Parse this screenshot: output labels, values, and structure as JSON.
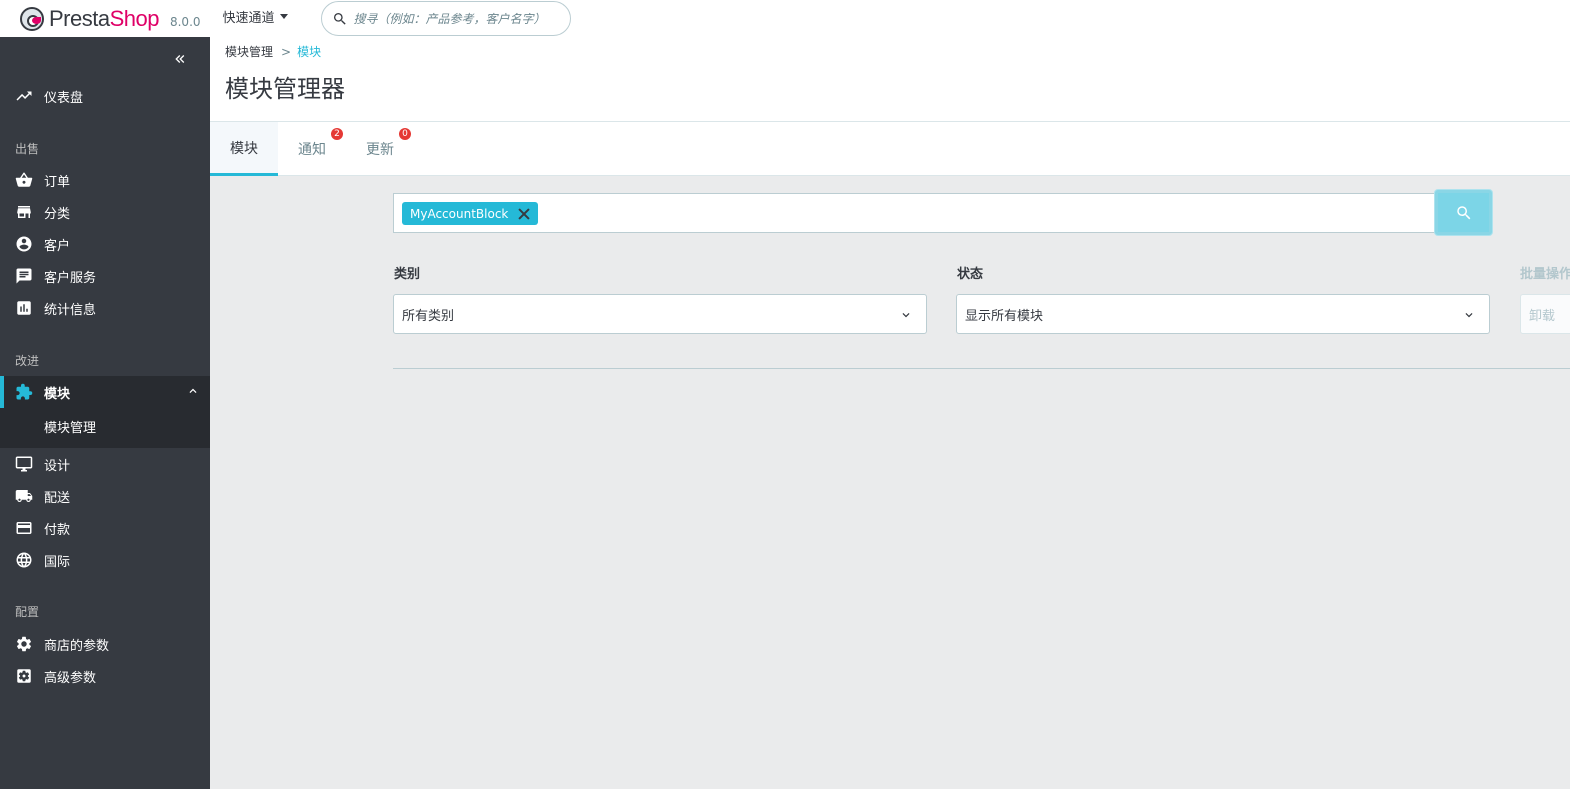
{
  "header": {
    "logo_prefix": "Presta",
    "logo_suffix": "Shop",
    "version": "8.0.0",
    "quick_access": "快速通道",
    "search_placeholder": "搜寻（例如：产品参考，客户名字）"
  },
  "sidebar": {
    "dashboard": "仪表盘",
    "section_sell": "出售",
    "orders": "订单",
    "catalog": "分类",
    "customers": "客户",
    "customer_service": "客户服务",
    "stats": "统计信息",
    "section_improve": "改进",
    "modules": "模块",
    "module_manager": "模块管理",
    "design": "设计",
    "shipping": "配送",
    "payment": "付款",
    "international": "国际",
    "section_configure": "配置",
    "shop_params": "商店的参数",
    "advanced_params": "高级参数"
  },
  "breadcrumb": {
    "parent": "模块管理",
    "separator": ">",
    "current": "模块"
  },
  "page_title": "模块管理器",
  "tabs": [
    {
      "label": "模块",
      "badge": ""
    },
    {
      "label": "通知",
      "badge": "2"
    },
    {
      "label": "更新",
      "badge": "0"
    }
  ],
  "module_search": {
    "tag": "MyAccountBlock"
  },
  "filters": {
    "category_label": "类别",
    "category_value": "所有类别",
    "status_label": "状态",
    "status_value": "显示所有模块",
    "bulk_label": "批量操作",
    "bulk_value": "卸载"
  },
  "colors": {
    "accent": "#25b9d7",
    "brand_pink": "#df0067",
    "sidebar_bg": "#363a41",
    "badge_red": "#e53935"
  }
}
